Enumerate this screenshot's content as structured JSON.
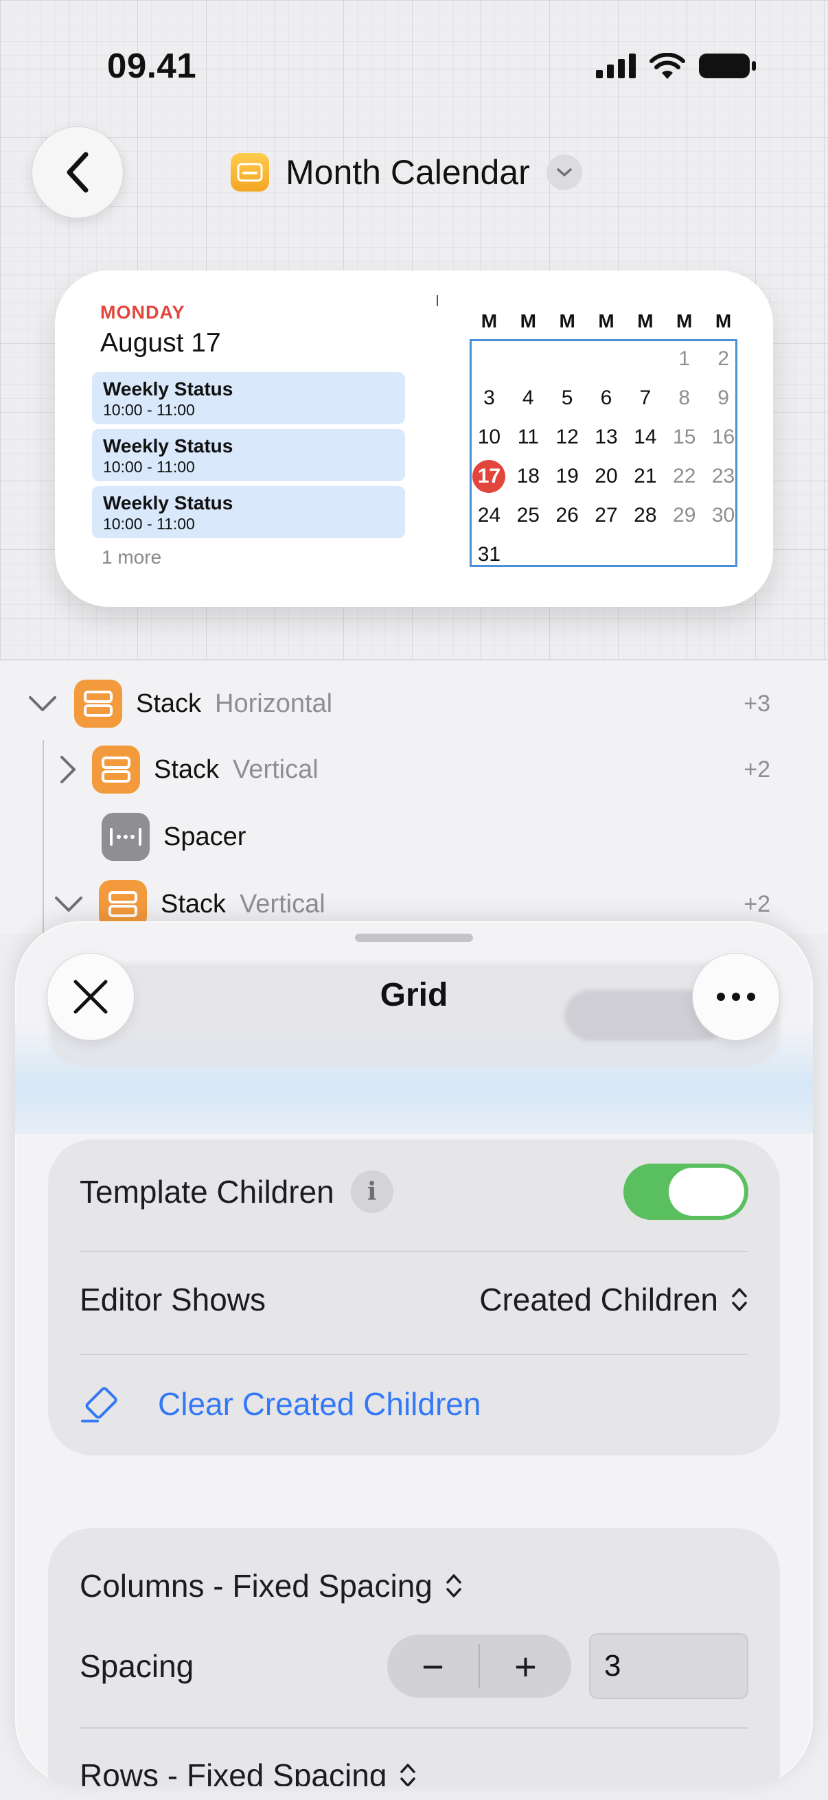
{
  "status_bar": {
    "time": "09.41"
  },
  "header": {
    "title": "Month Calendar"
  },
  "widget": {
    "weekday": "MONDAY",
    "date": "August 17",
    "events": [
      {
        "title": "Weekly Status",
        "time": "10:00 - 11:00"
      },
      {
        "title": "Weekly Status",
        "time": "10:00 - 11:00"
      },
      {
        "title": "Weekly Status",
        "time": "10:00 - 11:00"
      }
    ],
    "more": "1 more",
    "calendar": {
      "weekday_headers": [
        "M",
        "M",
        "M",
        "M",
        "M",
        "M",
        "M"
      ],
      "days": [
        "",
        "",
        "",
        "",
        "",
        "1",
        "2",
        "3",
        "4",
        "5",
        "6",
        "7",
        "8",
        "9",
        "10",
        "11",
        "12",
        "13",
        "14",
        "15",
        "16",
        "17",
        "18",
        "19",
        "20",
        "21",
        "22",
        "23",
        "24",
        "25",
        "26",
        "27",
        "28",
        "29",
        "30",
        "31",
        "",
        "",
        "",
        "",
        "",
        ""
      ],
      "today": "17",
      "today_color": "#e2453c",
      "selection_color": "#4a90d9"
    }
  },
  "tree": {
    "rows": [
      {
        "name": "Stack",
        "sub": "Horizontal",
        "count": "+3",
        "icon": "stack-icon"
      },
      {
        "name": "Stack",
        "sub": "Vertical",
        "count": "+2",
        "icon": "stack-icon"
      },
      {
        "name": "Spacer",
        "sub": "",
        "count": "",
        "icon": "spacer-icon"
      },
      {
        "name": "Stack",
        "sub": "Vertical",
        "count": "+2",
        "icon": "stack-icon"
      }
    ]
  },
  "sheet": {
    "title": "Grid",
    "template_children_label": "Template Children",
    "template_children_on": true,
    "editor_shows_label": "Editor Shows",
    "editor_shows_value": "Created Children",
    "clear_label": "Clear Created Children",
    "columns_label": "Columns - Fixed Spacing",
    "spacing_label": "Spacing",
    "spacing_value": "3",
    "stepper_minus": "−",
    "stepper_plus": "+",
    "rows_label": "Rows - Fixed Spacing",
    "accent_color": "#3478f6",
    "toggle_color": "#5ac05f"
  }
}
